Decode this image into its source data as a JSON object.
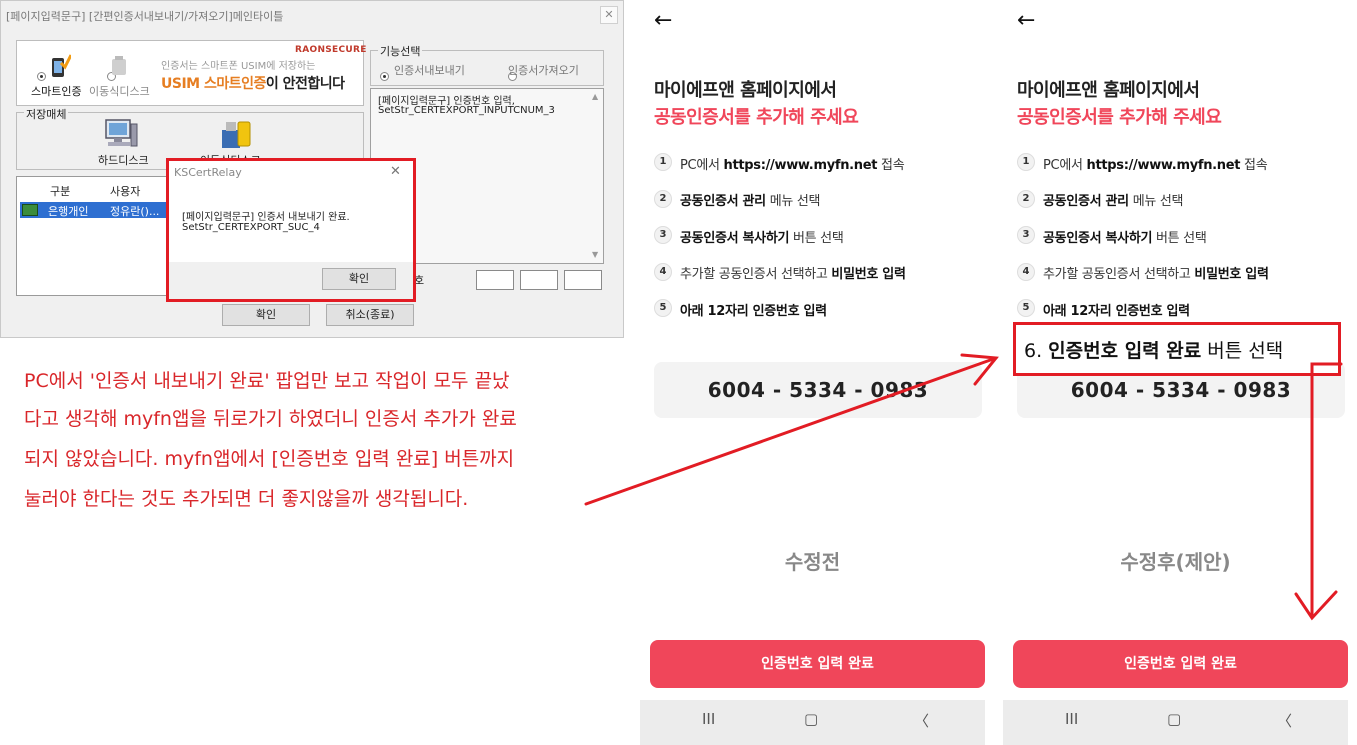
{
  "dialog": {
    "title": "[페이지입력문구] [간편인증서내보내기/가져오기]메인타이틀",
    "close_glyph": "✕",
    "banner": {
      "brand": "RAONSECURE",
      "line1": "인증서는 스마트폰 USIM에 저장하는",
      "line2_orange": "USIM 스마트인증",
      "line2_rest": "이 안전합니다",
      "option1": "스마트인증",
      "option2": "이동식디스크"
    },
    "storage_label": "저장매체",
    "storage_hd": "하드디스크",
    "storage_usb": "이동식디스크",
    "list_headers": [
      "구분",
      "사용자"
    ],
    "list_row": [
      "은행개인",
      "정유란()..."
    ],
    "function_label": "기능선택",
    "function_opt1": "인증서내보내기",
    "function_opt2": "인증서가져오기",
    "message_line1": "[페이지입력문구]  인증번호 입력,",
    "message_line2": "SetStr_CERTEXPORT_INPUTCNUM_3",
    "label_fragment": "호",
    "ok": "확인",
    "cancel": "취소(종료)",
    "popup": {
      "title": "KSCertRelay",
      "close_glyph": "✕",
      "line1": "[페이지입력문구]  인증서 내보내기 완료.",
      "line2": "SetStr_CERTEXPORT_SUC_4",
      "ok": "확인"
    }
  },
  "annotation": {
    "lines": [
      "PC에서 '인증서 내보내기 완료' 팝업만 보고 작업이 모두 끝났",
      "다고 생각해 myfn앱을 뒤로가기 하였더니 인증서 추가가 완료",
      "되지 않았습니다. myfn앱에서 [인증번호 입력 완료] 버튼까지",
      "눌러야 한다는 것도 추가되면 더 좋지않을까 생각됩니다."
    ]
  },
  "phone": {
    "back_glyph": "←",
    "title_line1": "마이에프앤 홈페이지에서",
    "title_line2": "공동인증서를 추가해 주세요",
    "steps": [
      {
        "num": "1",
        "pre": "PC에서 ",
        "bold": "https://www.myfn.net",
        "post": " 접속"
      },
      {
        "num": "2",
        "pre": "",
        "bold": "공동인증서 관리",
        "post": " 메뉴 선택"
      },
      {
        "num": "3",
        "pre": "",
        "bold": "공동인증서 복사하기",
        "post": " 버튼 선택"
      },
      {
        "num": "4",
        "pre": "추가할 공동인증서 선택하고 ",
        "bold": "비밀번호 입력",
        "post": ""
      },
      {
        "num": "5",
        "pre": "",
        "bold": "아래 12자리 인증번호 입력",
        "post": ""
      }
    ],
    "code": "6004  -  5334  -  0983",
    "submit": "인증번호 입력 완료",
    "nav": [
      "III",
      "▢",
      "〈"
    ]
  },
  "captions": {
    "before": "수정전",
    "after": "수정후(제안)"
  },
  "callout": {
    "pre": "6. ",
    "bold": "인증번호 입력 완료",
    "post": " 버튼 선택"
  },
  "colors": {
    "accent_red": "#f0465a",
    "annotation_red": "#d9262a",
    "highlight_border": "#e21c24"
  }
}
